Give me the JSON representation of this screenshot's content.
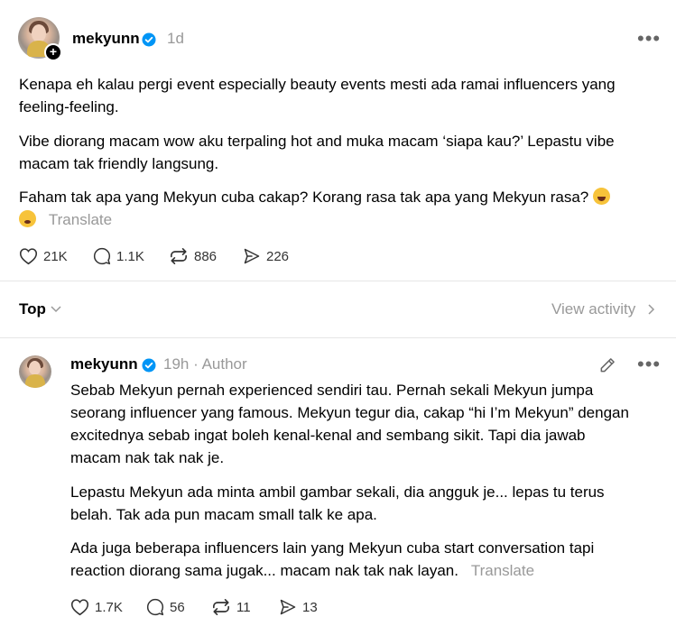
{
  "post": {
    "username": "mekyunn",
    "time": "1d",
    "paragraphs": [
      "Kenapa eh kalau pergi event especially beauty events mesti ada ramai influencers yang feeling-feeling.",
      "Vibe diorang macam wow aku terpaling hot and muka macam ‘siapa kau?’ Lepastu vibe macam tak friendly langsung.",
      "Faham tak apa yang Mekyun cuba cakap? Korang rasa tak apa yang Mekyun rasa?"
    ],
    "translate": "Translate",
    "likes": "21K",
    "replies": "1.1K",
    "reposts": "886",
    "shares": "226",
    "emojis": [
      "rolling-on-floor-laughing",
      "worried-sweat"
    ]
  },
  "sort": {
    "label": "Top",
    "view_activity": "View activity"
  },
  "reply": {
    "username": "mekyunn",
    "time": "19h",
    "separator": "·",
    "role": "Author",
    "paragraphs": [
      "Sebab Mekyun pernah experienced sendiri tau. Pernah sekali Mekyun jumpa seorang influencer yang famous. Mekyun tegur dia, cakap “hi I’m Mekyun” dengan excitednya sebab ingat boleh kenal-kenal and sembang sikit. Tapi dia jawab macam nak tak nak je.",
      "Lepastu Mekyun ada minta ambil gambar sekali, dia angguk je... lepas tu terus belah. Tak ada pun macam small talk ke apa.",
      "Ada juga beberapa influencers lain yang Mekyun cuba start conversation tapi reaction diorang sama jugak... macam nak tak nak layan."
    ],
    "translate": "Translate",
    "likes": "1.7K",
    "replies": "56",
    "reposts": "11",
    "shares": "13"
  },
  "colors": {
    "verified": "#0095f6",
    "muted": "#999999"
  }
}
